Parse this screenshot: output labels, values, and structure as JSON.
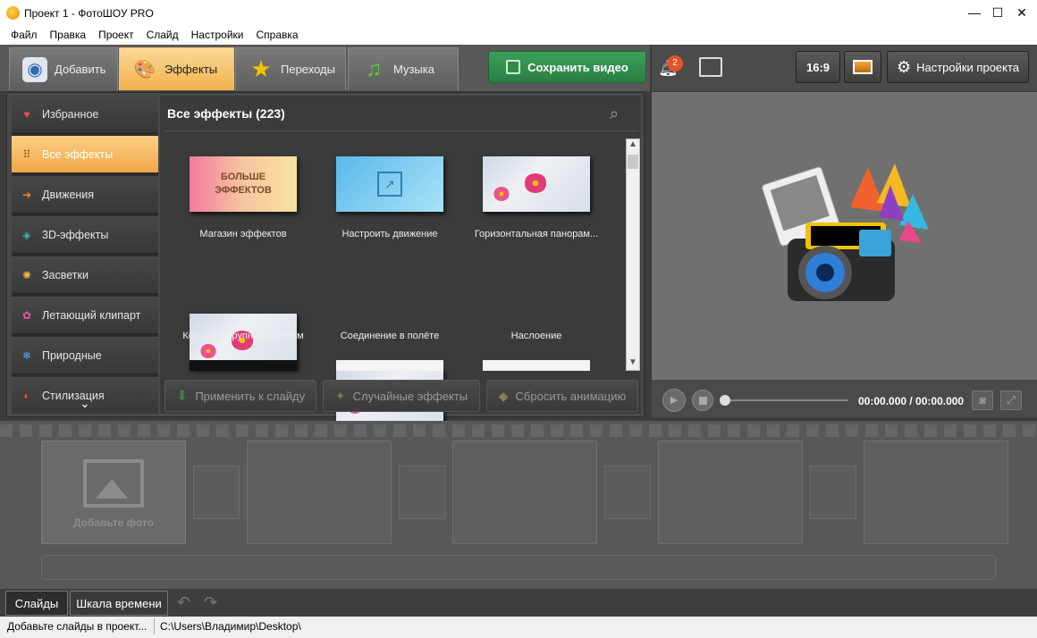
{
  "window": {
    "title": "Проект 1 - ФотоШОУ PRO",
    "minimize": "—",
    "maximize": "☐",
    "close": "✕"
  },
  "menu": [
    "Файл",
    "Правка",
    "Проект",
    "Слайд",
    "Настройки",
    "Справка"
  ],
  "tabs": [
    {
      "label": "Добавить",
      "icon": "camera-icon"
    },
    {
      "label": "Эффекты",
      "icon": "palette-icon",
      "active": true
    },
    {
      "label": "Переходы",
      "icon": "star-icon"
    },
    {
      "label": "Музыка",
      "icon": "music-note-icon"
    }
  ],
  "save_button": "Сохранить видео",
  "notifications": {
    "count": "2"
  },
  "right_toolbar": {
    "aspect": "16:9",
    "settings": "Настройки проекта"
  },
  "categories": [
    {
      "label": "Избранное",
      "icon": "heart-icon"
    },
    {
      "label": "Все эффекты",
      "icon": "grid-icon",
      "active": true
    },
    {
      "label": "Движения",
      "icon": "arrow-right-icon"
    },
    {
      "label": "3D-эффекты",
      "icon": "cube-icon"
    },
    {
      "label": "Засветки",
      "icon": "sun-icon"
    },
    {
      "label": "Летающий клипарт",
      "icon": "clipart-icon"
    },
    {
      "label": "Природные",
      "icon": "snowflake-icon"
    },
    {
      "label": "Стилизация",
      "icon": "style-icon"
    }
  ],
  "effects": {
    "title": "Все эффекты (223)",
    "items": [
      {
        "label": "Магазин эффектов",
        "thumb_text": "БОЛЬШЕ ЭФФЕКТОВ"
      },
      {
        "label": "Настроить движение"
      },
      {
        "label": "Горизонтальная панорам..."
      },
      {
        "label": "Коллаж с крупным планом"
      },
      {
        "label": "Соединение в полёте"
      },
      {
        "label": "Наслоение"
      }
    ]
  },
  "actions": {
    "apply": "Применить к слайду",
    "random": "Случайные эффекты",
    "reset": "Сбросить анимацию"
  },
  "player": {
    "time": "00:00.000 / 00:00.000"
  },
  "timeline": {
    "add_photo": "Добавьте фото"
  },
  "bottom_tabs": [
    "Слайды",
    "Шкала времени"
  ],
  "status": {
    "left": "Добавьте слайды в проект...",
    "path": "C:\\Users\\Владимир\\Desktop\\"
  }
}
